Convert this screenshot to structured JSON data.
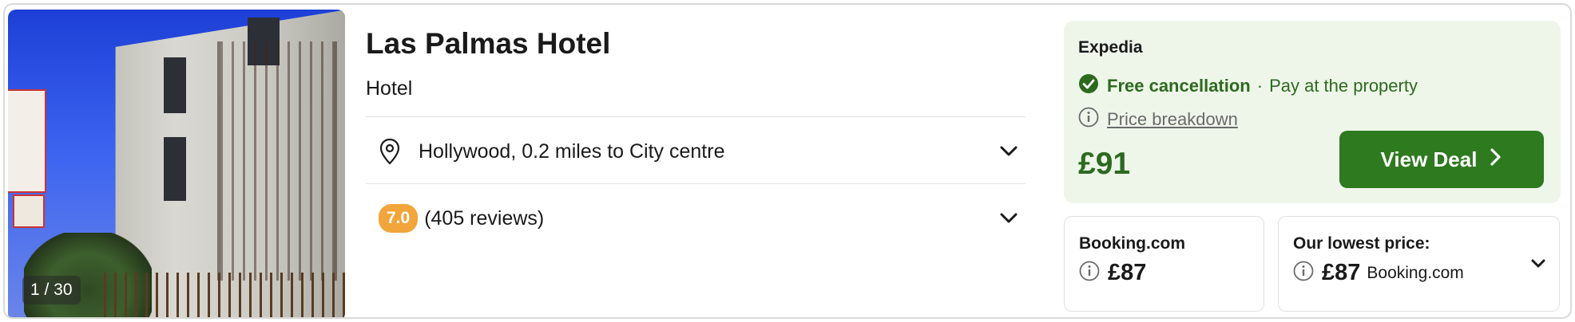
{
  "hotel": {
    "name": "Las Palmas Hotel",
    "type": "Hotel",
    "photo_counter": "1 / 30",
    "location": "Hollywood, 0.2 miles to City centre",
    "rating_score": "7.0",
    "reviews": "(405 reviews)"
  },
  "deal": {
    "provider": "Expedia",
    "free_cancellation": "Free cancellation",
    "separator": "·",
    "pay_note": "Pay at the property",
    "price_breakdown": "Price breakdown",
    "price": "£91",
    "button_label": "View Deal"
  },
  "alt_offers": {
    "booking": {
      "name": "Booking.com",
      "price": "£87"
    },
    "lowest": {
      "label": "Our lowest price:",
      "price": "£87",
      "source": "Booking.com"
    }
  },
  "colors": {
    "accent_green": "#2e7a1f",
    "deal_bg": "#eef6ea",
    "score_badge": "#f1a53b"
  },
  "icons": [
    "location-pin-icon",
    "chevron-down-icon",
    "check-circle-icon",
    "info-icon",
    "chevron-right-icon"
  ]
}
